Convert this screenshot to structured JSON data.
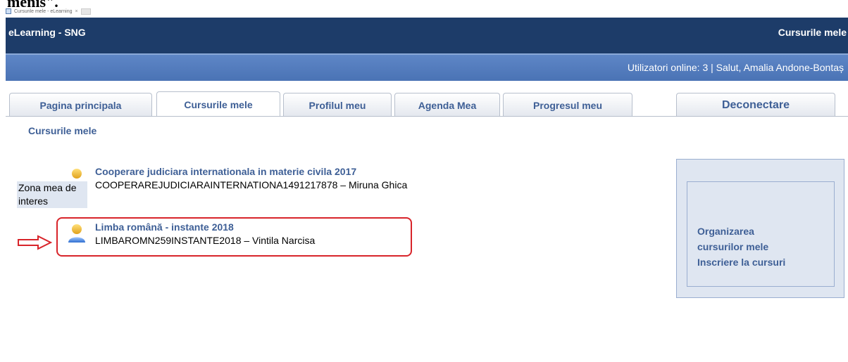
{
  "cropped_heading": "menis\".",
  "browser": {
    "tab_title": "Cursurile mele - eLearning"
  },
  "header": {
    "app_title": "eLearning - SNG",
    "page_heading": "Cursurile mele"
  },
  "userbar": {
    "text": "Utilizatori online:  3  | Salut, Amalia Andone-Bontaș"
  },
  "tabs": [
    {
      "label": "Pagina principala",
      "active": false
    },
    {
      "label": "Cursurile mele",
      "active": true
    },
    {
      "label": "Profilul meu",
      "active": false
    },
    {
      "label": "Agenda Mea",
      "active": false
    },
    {
      "label": "Progresul meu",
      "active": false
    },
    {
      "label": "Deconectare",
      "active": false
    }
  ],
  "breadcrumb": "Cursurile mele",
  "courses": [
    {
      "title": "Cooperare judiciara internationala in materie civila 2017",
      "subtitle": "COOPERAREJUDICIARAINTERNATIONA1491217878 – Miruna Ghica"
    },
    {
      "title": "Limba română - instante 2018",
      "subtitle": "LIMBAROMN259INSTANTE2018 – Vintila Narcisa"
    }
  ],
  "side_panel": {
    "legend": "Zona mea de interes",
    "links": [
      "Organizarea cursurilor mele",
      "Inscriere la cursuri"
    ]
  },
  "colors": {
    "topbar": "#1d3c69",
    "userbar": "#4a73b5",
    "link": "#3e5f96",
    "highlight": "#d8242a"
  },
  "icons": [
    "user-icon",
    "right-arrow-icon",
    "favicon-icon"
  ]
}
